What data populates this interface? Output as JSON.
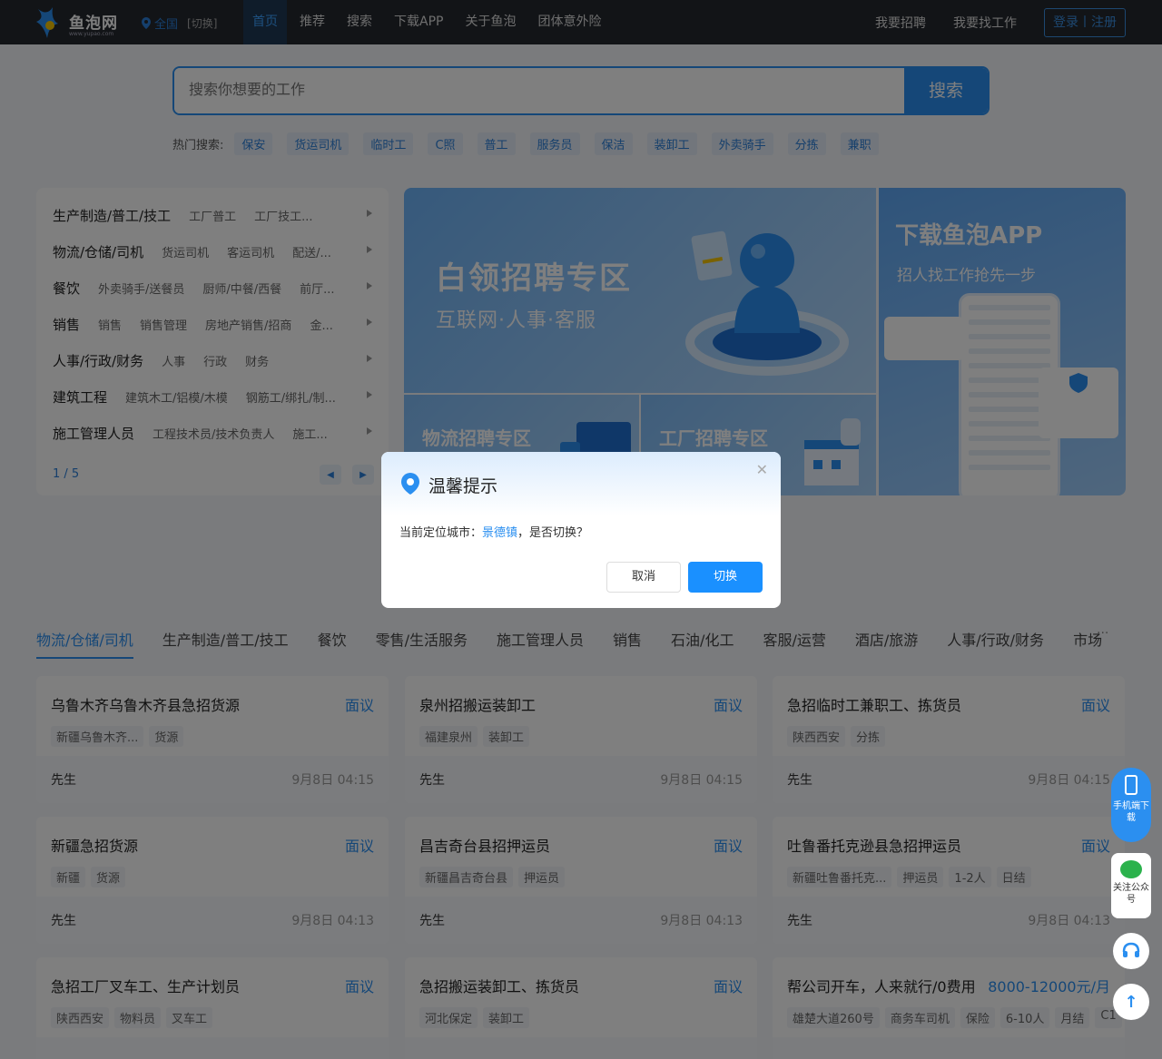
{
  "header": {
    "logo_name": "鱼泡网",
    "logo_url": "www.yupao.com",
    "location": "全国",
    "location_switch": "[切换]",
    "nav": [
      "首页",
      "推荐",
      "搜索",
      "下载APP",
      "关于鱼泡",
      "团体意外险"
    ],
    "post_job": "我要招聘",
    "find_job": "我要找工作",
    "login": "登录丨注册"
  },
  "search": {
    "placeholder": "搜索你想要的工作",
    "button": "搜索",
    "hot_label": "热门搜索:",
    "hot_tags": [
      "保安",
      "货运司机",
      "临时工",
      "C照",
      "普工",
      "服务员",
      "保洁",
      "装卸工",
      "外卖骑手",
      "分拣",
      "兼职"
    ]
  },
  "categories": {
    "rows": [
      {
        "main": "生产制造/普工/技工",
        "subs": [
          "工厂普工",
          "工厂技工..."
        ]
      },
      {
        "main": "物流/仓储/司机",
        "subs": [
          "货运司机",
          "客运司机",
          "配送/..."
        ]
      },
      {
        "main": "餐饮",
        "subs": [
          "外卖骑手/送餐员",
          "厨师/中餐/西餐",
          "前厅..."
        ]
      },
      {
        "main": "销售",
        "subs": [
          "销售",
          "销售管理",
          "房地产销售/招商",
          "金..."
        ]
      },
      {
        "main": "人事/行政/财务",
        "subs": [
          "人事",
          "行政",
          "财务"
        ]
      },
      {
        "main": "建筑工程",
        "subs": [
          "建筑木工/铝模/木模",
          "钢筋工/绑扎/制..."
        ]
      },
      {
        "main": "施工管理人员",
        "subs": [
          "工程技术员/技术负责人",
          "施工..."
        ]
      }
    ],
    "page": "1 / 5"
  },
  "banners": {
    "main_title": "白领招聘专区",
    "main_sub": "互联网·人事·客服",
    "logistics": "物流招聘专区",
    "factory": "工厂招聘专区",
    "app_title": "下载鱼泡APP",
    "app_sub": "招人找工作抢先一步"
  },
  "tabs": [
    "物流/仓储/司机",
    "生产制造/普工/技工",
    "餐饮",
    "零售/生活服务",
    "施工管理人员",
    "销售",
    "石油/化工",
    "客服/运营",
    "酒店/旅游",
    "人事/行政/财务",
    "市场"
  ],
  "tabs_more": "···",
  "jobs": [
    {
      "title": "乌鲁木齐乌鲁木齐县急招货源",
      "pay": "面议",
      "tags": [
        "新疆乌鲁木齐...",
        "货源"
      ],
      "name": "先生",
      "date": "9月8日 04:15"
    },
    {
      "title": "泉州招搬运装卸工",
      "pay": "面议",
      "tags": [
        "福建泉州",
        "装卸工"
      ],
      "name": "先生",
      "date": "9月8日 04:15"
    },
    {
      "title": "急招临时工兼职工、拣货员",
      "pay": "面议",
      "tags": [
        "陕西西安",
        "分拣"
      ],
      "name": "先生",
      "date": "9月8日 04:15"
    },
    {
      "title": "新疆急招货源",
      "pay": "面议",
      "tags": [
        "新疆",
        "货源"
      ],
      "name": "先生",
      "date": "9月8日 04:13"
    },
    {
      "title": "昌吉奇台县招押运员",
      "pay": "面议",
      "tags": [
        "新疆昌吉奇台县",
        "押运员"
      ],
      "name": "先生",
      "date": "9月8日 04:13"
    },
    {
      "title": "吐鲁番托克逊县急招押运员",
      "pay": "面议",
      "tags": [
        "新疆吐鲁番托克...",
        "押运员",
        "1-2人",
        "日结"
      ],
      "name": "先生",
      "date": "9月8日 04:13"
    },
    {
      "title": "急招工厂叉车工、生产计划员",
      "pay": "面议",
      "tags": [
        "陕西西安",
        "物料员",
        "叉车工"
      ],
      "name": "",
      "date": ""
    },
    {
      "title": "急招搬运装卸工、拣货员",
      "pay": "面议",
      "tags": [
        "河北保定",
        "装卸工"
      ],
      "name": "",
      "date": ""
    },
    {
      "title": "帮公司开车，人来就行/0费用",
      "pay": "8000-12000元/月",
      "tags": [
        "雄楚大道260号",
        "商务车司机",
        "保险",
        "6-10人",
        "月结",
        "C1"
      ],
      "name": "",
      "date": ""
    }
  ],
  "side": {
    "app": "手机端下载",
    "wechat": "关注公众号"
  },
  "modal": {
    "title": "温馨提示",
    "msg_prefix": "当前定位城市：",
    "city": "景德镇",
    "msg_suffix": "，是否切换？",
    "cancel": "取消",
    "confirm": "切换"
  }
}
